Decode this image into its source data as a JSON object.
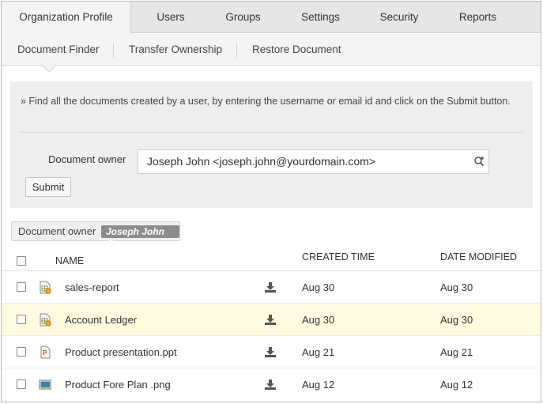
{
  "top_tabs": [
    {
      "label": "Organization Profile",
      "active": true
    },
    {
      "label": "Users",
      "active": false
    },
    {
      "label": "Groups",
      "active": false
    },
    {
      "label": "Settings",
      "active": false
    },
    {
      "label": "Security",
      "active": false
    },
    {
      "label": "Reports",
      "active": false
    }
  ],
  "sub_tabs": [
    {
      "label": "Document Finder",
      "active": true
    },
    {
      "label": "Transfer Ownership",
      "active": false
    },
    {
      "label": "Restore Document",
      "active": false
    }
  ],
  "finder": {
    "hint": "» Find all the documents created by a user, by entering the username or email id and click on the Submit button.",
    "owner_label": "Document owner",
    "owner_value": "Joseph John <joseph.john@yourdomain.com>",
    "submit_label": "Submit"
  },
  "filter": {
    "label": "Document owner",
    "tag": "Joseph John @"
  },
  "table": {
    "headers": {
      "name": "NAME",
      "created": "CREATED TIME",
      "modified": "DATE MODIFIED"
    },
    "rows": [
      {
        "name": "sales-report",
        "icon": "spreadsheet-icon",
        "created": "Aug 30",
        "modified": "Aug 30",
        "highlighted": false
      },
      {
        "name": "Account Ledger",
        "icon": "spreadsheet-icon",
        "created": "Aug 30",
        "modified": "Aug 30",
        "highlighted": true
      },
      {
        "name": "Product presentation.ppt",
        "icon": "presentation-icon",
        "created": "Aug 21",
        "modified": "Aug 21",
        "highlighted": false
      },
      {
        "name": "Product Fore Plan .png",
        "icon": "image-icon",
        "created": "Aug 12",
        "modified": "Aug 12",
        "highlighted": false
      }
    ]
  },
  "colors": {
    "highlight_row": "#fffbe0",
    "panel": "#eeeeee",
    "tag": "#8c8c8c"
  }
}
